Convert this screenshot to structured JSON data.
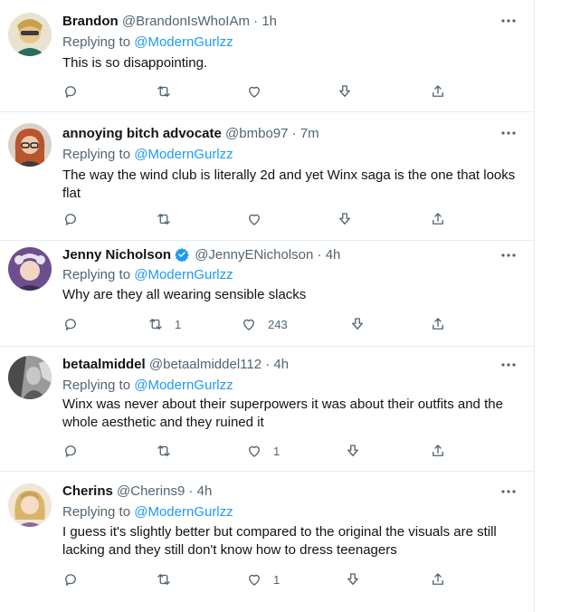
{
  "tweets": [
    {
      "name": "Brandon",
      "handle": "@BrandonIsWhoIAm",
      "dot": "·",
      "time": "1h",
      "reply_prefix": "Replying to ",
      "reply_to": "@ModernGurlzz",
      "text": "This is so disappointing.",
      "verified": false,
      "counts": {
        "reply": "",
        "retweet": "",
        "like": ""
      },
      "avatar_color": "#c8a24a"
    },
    {
      "name": "annoying bitch advocate",
      "handle": "@bmbo97",
      "dot": "·",
      "time": "7m",
      "reply_prefix": "Replying to ",
      "reply_to": "@ModernGurlzz",
      "text": "The way the wind club is literally 2d and yet Winx saga is the one that looks flat",
      "verified": false,
      "counts": {
        "reply": "",
        "retweet": "",
        "like": ""
      },
      "avatar_color": "#b8542e"
    },
    {
      "name": "Jenny Nicholson",
      "handle": "@JennyENicholson",
      "dot": "·",
      "time": "4h",
      "reply_prefix": "Replying to ",
      "reply_to": "@ModernGurlzz",
      "text": "Why are they all wearing sensible slacks",
      "verified": true,
      "counts": {
        "reply": "",
        "retweet": "1",
        "like": "243"
      },
      "avatar_color": "#7a5a9a"
    },
    {
      "name": "betaalmiddel",
      "handle": "@betaalmiddel112",
      "dot": "·",
      "time": "4h",
      "reply_prefix": "Replying to ",
      "reply_to": "@ModernGurlzz",
      "text": "Winx was never about their superpowers it was about their outfits and the whole aesthetic and they ruined it",
      "verified": false,
      "counts": {
        "reply": "",
        "retweet": "",
        "like": "1"
      },
      "avatar_color": "#6b6b6b"
    },
    {
      "name": "Cherins",
      "handle": "@Cherins9",
      "dot": "·",
      "time": "4h",
      "reply_prefix": "Replying to ",
      "reply_to": "@ModernGurlzz",
      "text": "I guess it's slightly better but compared to the original the visuals are still lacking and they still don't know how to dress teenagers",
      "verified": false,
      "counts": {
        "reply": "",
        "retweet": "",
        "like": "1"
      },
      "avatar_color": "#d9b56a"
    }
  ],
  "colors": {
    "accent": "#1d9bf0",
    "secondary_text": "#536471",
    "border": "#e6ecf0"
  }
}
